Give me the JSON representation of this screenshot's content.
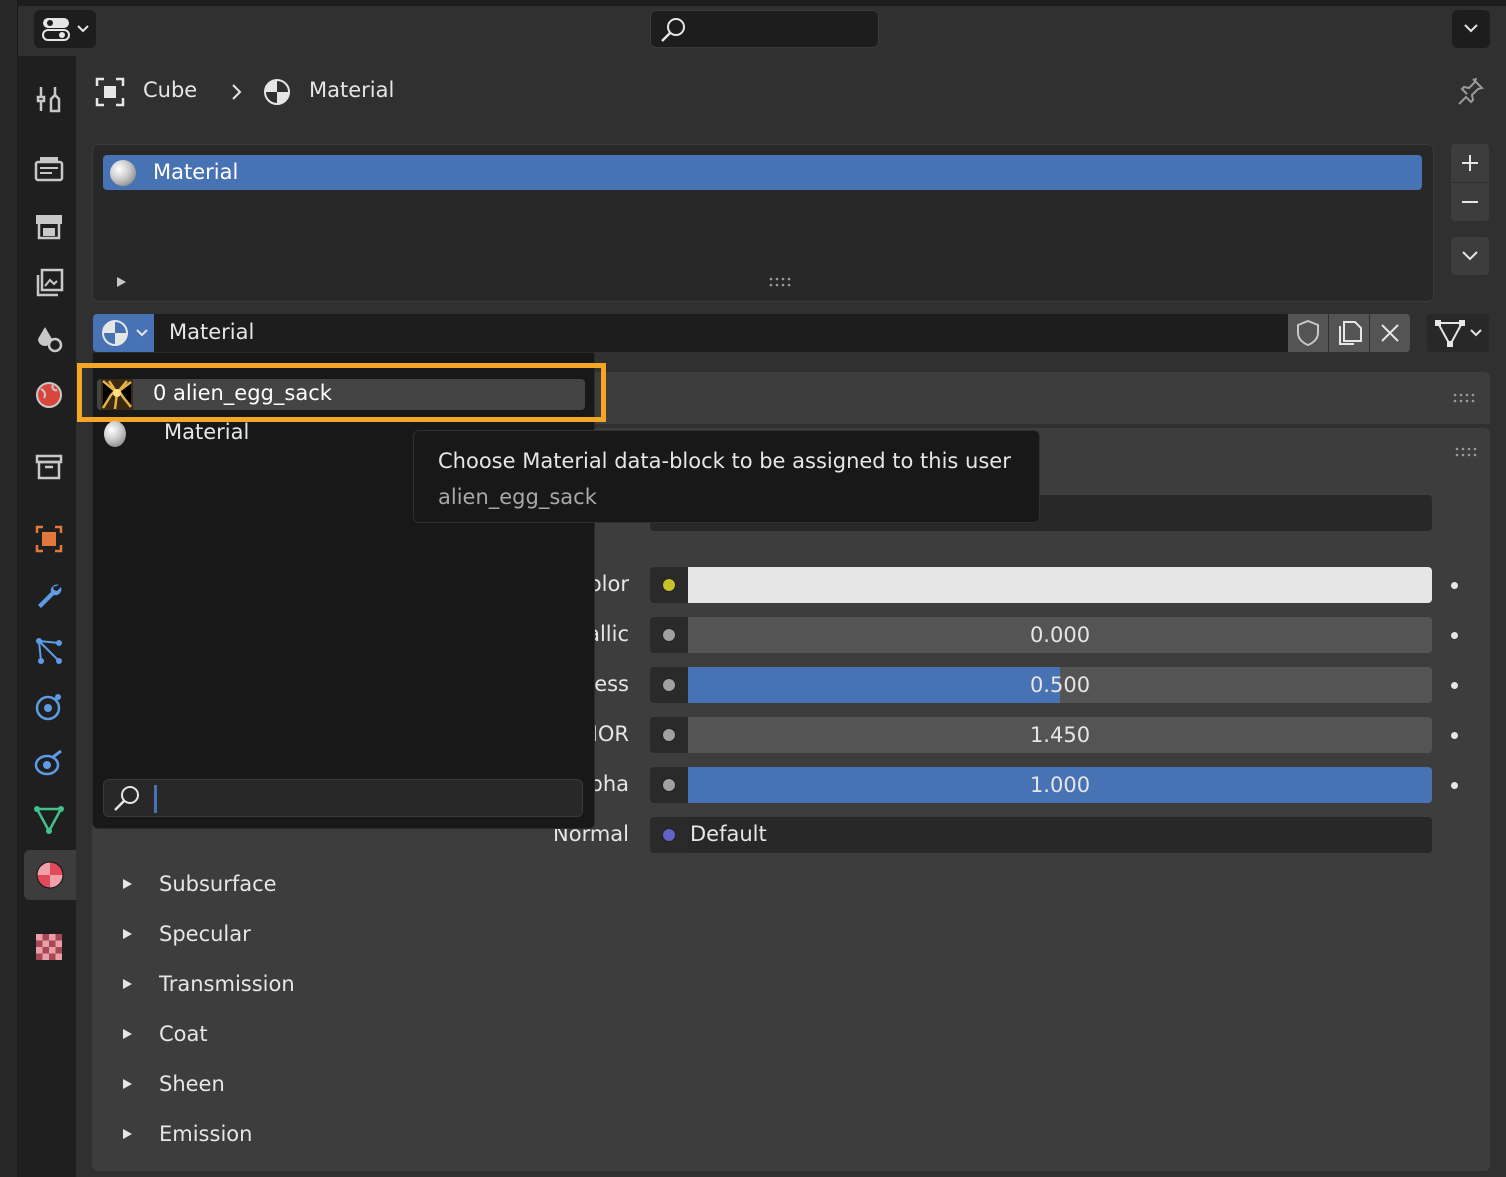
{
  "header": {
    "search_placeholder": ""
  },
  "breadcrumb": {
    "object": "Cube",
    "separator": "›",
    "data": "Material"
  },
  "material_slots": {
    "items": [
      {
        "label": "Material"
      }
    ]
  },
  "id_block": {
    "name": "Material"
  },
  "dropdown": {
    "items": [
      {
        "label": "0 alien_egg_sack",
        "highlighted": true
      },
      {
        "label": "Material",
        "highlighted": false
      }
    ],
    "search_value": ""
  },
  "tooltip": {
    "title": "Choose Material data-block to be assigned to this user",
    "subtitle": "alien_egg_sack"
  },
  "properties": {
    "rows": [
      {
        "label": "olor",
        "socket_color": "#c8c229",
        "value": "",
        "fill": 1.0,
        "kind": "color"
      },
      {
        "label": "allic",
        "socket_color": "#a1a1a1",
        "value": "0.000",
        "fill": 0.0,
        "kind": "slider"
      },
      {
        "label": "ess",
        "socket_color": "#a1a1a1",
        "value": "0.500",
        "fill": 0.5,
        "kind": "slider"
      },
      {
        "label": "IOR",
        "socket_color": "#a1a1a1",
        "value": "1.450",
        "fill": 0.0,
        "kind": "slider"
      },
      {
        "label": "pha",
        "socket_color": "#a1a1a1",
        "value": "1.000",
        "fill": 1.0,
        "kind": "slider"
      },
      {
        "label": "Normal",
        "socket_color": "#6363c7",
        "value": "Default",
        "fill": 0.0,
        "kind": "text"
      }
    ],
    "subpanels": [
      "Subsurface",
      "Specular",
      "Transmission",
      "Coat",
      "Sheen",
      "Emission"
    ]
  },
  "colors": {
    "accent": "#4772b3",
    "highlight_outline": "#f5a623",
    "base_color_swatch": "#e6e6e6"
  }
}
